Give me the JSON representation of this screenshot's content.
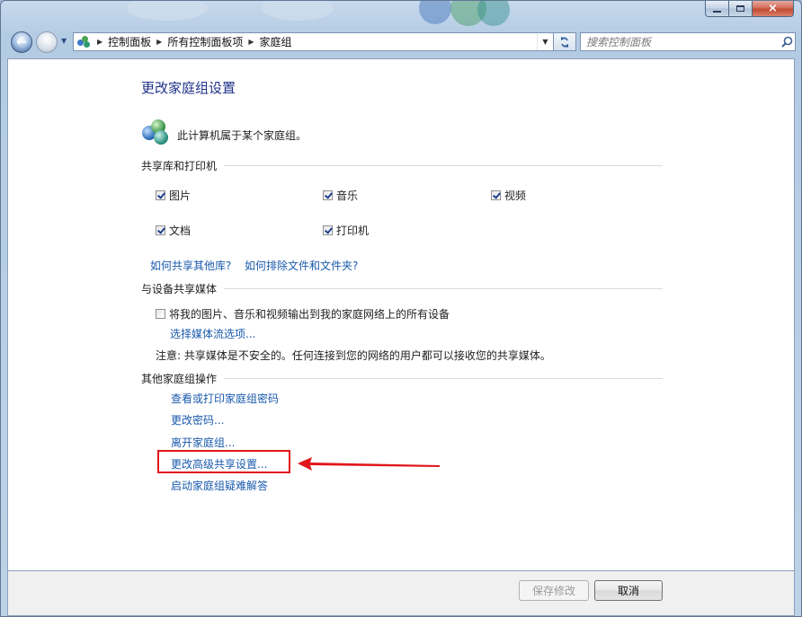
{
  "window": {
    "caption_buttons": {
      "minimize": "minimize",
      "maximize": "maximize",
      "close": "×"
    }
  },
  "nav": {
    "back": "←",
    "forward": "→",
    "breadcrumbs": [
      "控制面板",
      "所有控制面板项",
      "家庭组"
    ],
    "search_placeholder": "搜索控制面板"
  },
  "page": {
    "title": "更改家庭组设置",
    "status": "此计算机属于某个家庭组。",
    "section_libraries": "共享库和打印机",
    "libraries": [
      {
        "label": "图片",
        "checked": true
      },
      {
        "label": "音乐",
        "checked": true
      },
      {
        "label": "视频",
        "checked": true
      },
      {
        "label": "文档",
        "checked": true
      },
      {
        "label": "打印机",
        "checked": true
      }
    ],
    "link_share_other": "如何共享其他库?",
    "link_exclude": "如何排除文件和文件夹?",
    "section_media": "与设备共享媒体",
    "media_checkbox_label": "将我的图片、音乐和视频输出到我的家庭网络上的所有设备",
    "media_checkbox_checked": false,
    "link_media_options": "选择媒体流选项...",
    "media_note": "注意: 共享媒体是不安全的。任何连接到您的网络的用户都可以接收您的共享媒体。",
    "section_other": "其他家庭组操作",
    "actions": [
      "查看或打印家庭组密码",
      "更改密码...",
      "离开家庭组...",
      "更改高级共享设置...",
      "启动家庭组疑难解答"
    ]
  },
  "footer": {
    "save": "保存修改",
    "cancel": "取消"
  },
  "colors": {
    "link": "#1a5aad",
    "title": "#1e3287",
    "highlight": "#e0161b"
  }
}
